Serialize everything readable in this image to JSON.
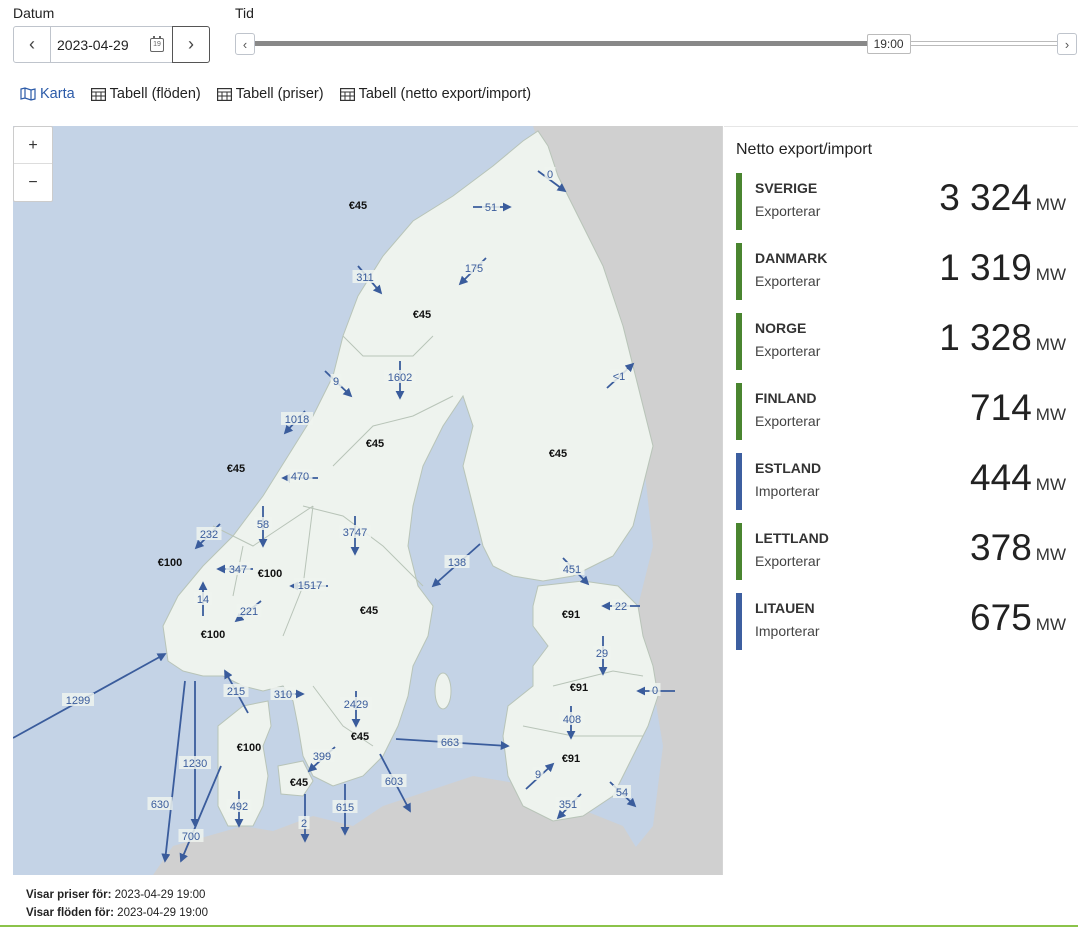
{
  "controls": {
    "date_label": "Datum",
    "time_label": "Tid",
    "date_value": "2023-04-29",
    "time_value": "19:00",
    "time_progress": 0.79
  },
  "tabs": [
    {
      "label": "Karta",
      "icon": "map-icon",
      "active": true
    },
    {
      "label": "Tabell (flöden)",
      "icon": "table-icon",
      "active": false
    },
    {
      "label": "Tabell (priser)",
      "icon": "table-icon",
      "active": false
    },
    {
      "label": "Tabell (netto export/import)",
      "icon": "table-icon",
      "active": false
    }
  ],
  "map": {
    "zoom_in": "+",
    "zoom_out": "−",
    "prices": [
      "€45",
      "€45",
      "€45",
      "€45",
      "€45",
      "€45",
      "€45",
      "€100",
      "€100",
      "€100",
      "€100",
      "€91",
      "€91",
      "€91",
      "€45"
    ],
    "flows": [
      "0",
      "51",
      "311",
      "175",
      "1602",
      "9",
      "1018",
      "470",
      "<1",
      "58",
      "232",
      "3747",
      "347",
      "1517",
      "14",
      "221",
      "138",
      "451",
      "22",
      "29",
      "0",
      "215",
      "310",
      "2429",
      "1299",
      "1230",
      "408",
      "399",
      "663",
      "9",
      "492",
      "630",
      "700",
      "2",
      "615",
      "603",
      "351",
      "54"
    ]
  },
  "panel": {
    "title": "Netto export/import",
    "unit": "MW",
    "colors": {
      "export": "#4a8530",
      "import": "#3d5fa0"
    },
    "countries": [
      {
        "name": "SVERIGE",
        "status": "Exporterar",
        "value": "3 324",
        "type": "export"
      },
      {
        "name": "DANMARK",
        "status": "Exporterar",
        "value": "1 319",
        "type": "export"
      },
      {
        "name": "NORGE",
        "status": "Exporterar",
        "value": "1 328",
        "type": "export"
      },
      {
        "name": "FINLAND",
        "status": "Exporterar",
        "value": "714",
        "type": "export"
      },
      {
        "name": "ESTLAND",
        "status": "Importerar",
        "value": "444",
        "type": "import"
      },
      {
        "name": "LETTLAND",
        "status": "Exporterar",
        "value": "378",
        "type": "export"
      },
      {
        "name": "LITAUEN",
        "status": "Importerar",
        "value": "675",
        "type": "import"
      }
    ]
  },
  "footer": {
    "prices_label": "Visar priser för:",
    "prices_value": "2023-04-29 19:00",
    "flows_label": "Visar flöden för:",
    "flows_value": "2023-04-29 19:00"
  }
}
